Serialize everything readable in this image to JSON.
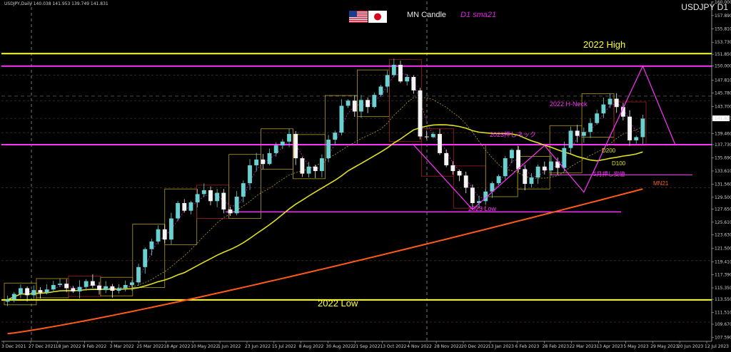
{
  "header": {
    "ohlc_text": "USDJPY,Daily 140.038 141.953 139.749 141.831",
    "symbol_label": "USDJPY D1",
    "candle_label": "MN Candle",
    "sma_label": "D1 sma21",
    "flag_icons": [
      "us-flag-icon",
      "japan-flag-icon"
    ]
  },
  "annotations": {
    "high_2022": "2022 High",
    "low_2022": "2022 Low",
    "low_2023": "2023 Low",
    "neck_2022h": "2022 H-Neck",
    "neck_2023": "2023押しネック",
    "d200": "D200",
    "d100": "D100",
    "may_low": "5月押し安値",
    "mn21": "MN21"
  },
  "colors": {
    "background": "#000000",
    "up_candle": "#6ad0d0",
    "down_candle": "#f4f4f4",
    "yellow_line": "#ffff33",
    "magenta_line": "#ff33ff",
    "mn21_line": "#ff5a1a",
    "d200_line": "#e0e020",
    "d100_line": "#b8a030",
    "monthly_box_up": "#b39b1c",
    "monthly_box_down": "#a02020"
  },
  "chart_data": {
    "type": "candlestick",
    "symbol": "USDJPY",
    "timeframe": "D1",
    "ylim": [
      107.0,
      160.1
    ],
    "y_ticks": [
      "160.000",
      "157.890",
      "155.810",
      "153.730",
      "151.850",
      "150.000",
      "147.810",
      "145.780",
      "143.700",
      "141.831",
      "139.460",
      "137.730",
      "135.690",
      "133.610",
      "131.560",
      "129.500",
      "127.650",
      "125.610",
      "123.630",
      "121.500",
      "119.410",
      "117.390",
      "115.350",
      "113.550",
      "111.510",
      "109.670",
      "107.590"
    ],
    "x_ticks": [
      "3 Dec 2021",
      "27 Dec 2021",
      "18 Jan 2022",
      "9 Feb 2022",
      "3 Mar 2022",
      "25 Mar 2022",
      "18 Apr 2022",
      "10 May 2022",
      "1 Jun 2022",
      "23 Jun 2022",
      "15 Jul 2022",
      "8 Aug 2022",
      "30 Aug 2022",
      "21 Sep 2022",
      "13 Oct 2022",
      "4 Nov 2022",
      "28 Nov 2022",
      "20 Dec 2022",
      "13 Jan 2023",
      "6 Feb 2023",
      "28 Feb 2023",
      "22 Mar 2023",
      "13 Apr 2023",
      "5 May 2023",
      "29 May 2023",
      "20 Jun 2023",
      "12 Jul 2023"
    ],
    "current_price": 141.831,
    "levels": {
      "high_2022": 151.95,
      "low_2022": 113.47,
      "neck_2022h_magenta": 150.0,
      "neck_2023_magenta": 137.73,
      "low_2023_magenta": 127.22,
      "may_low_magenta": 133.0
    },
    "close_path": [
      113.5,
      114.4,
      115.3,
      114.2,
      115.0,
      114.6,
      115.1,
      115.8,
      116.0,
      115.3,
      114.8,
      115.5,
      116.4,
      115.7,
      115.0,
      115.6,
      114.9,
      115.3,
      115.8,
      116.2,
      118.6,
      121.4,
      122.6,
      124.5,
      122.9,
      126.2,
      128.6,
      127.4,
      128.7,
      130.0,
      130.6,
      128.9,
      130.2,
      127.6,
      127.0,
      129.6,
      131.7,
      134.5,
      135.4,
      134.7,
      136.4,
      137.6,
      138.2,
      139.4,
      135.6,
      133.2,
      134.3,
      133.6,
      135.6,
      138.5,
      139.6,
      143.8,
      144.6,
      142.9,
      144.7,
      143.6,
      145.5,
      146.8,
      148.6,
      150.2,
      147.6,
      148.3,
      146.2,
      139.0,
      138.9,
      139.4,
      136.4,
      134.5,
      133.6,
      132.9,
      131.0,
      128.6,
      128.9,
      130.4,
      131.7,
      132.8,
      135.6,
      136.9,
      133.9,
      131.6,
      132.6,
      134.3,
      133.7,
      135.1,
      134.1,
      137.2,
      139.9,
      139.1,
      139.7,
      141.1,
      142.6,
      144.0,
      144.9,
      143.6,
      142.1,
      138.4,
      138.9,
      141.8
    ]
  }
}
